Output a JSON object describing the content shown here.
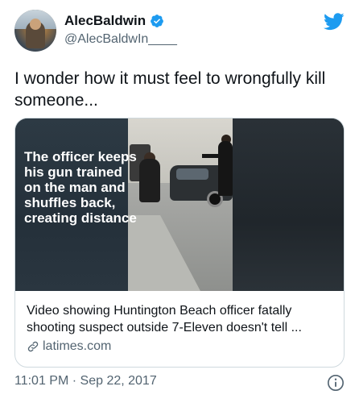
{
  "user": {
    "display_name": "AlecBaldwin",
    "handle": "@AlecBaldwIn____"
  },
  "tweet": {
    "text": "I wonder how it must feel to wrongfully kill someone..."
  },
  "card": {
    "overlay_text": "The officer keeps his gun trained on the man and shuffles back, creating distance",
    "title": "Video showing Huntington Beach officer fatally shooting suspect outside 7-Eleven doesn't tell ...",
    "domain": "latimes.com"
  },
  "meta": {
    "time": "11:01 PM",
    "separator": "·",
    "date": "Sep 22, 2017"
  },
  "colors": {
    "twitter_blue": "#1d9bf0",
    "text_primary": "#0f1419",
    "text_secondary": "#536471",
    "border": "#cfd9de"
  },
  "icons": {
    "verified": "verified-badge-icon",
    "brand": "twitter-bird-icon",
    "link": "link-icon",
    "info": "info-icon"
  }
}
